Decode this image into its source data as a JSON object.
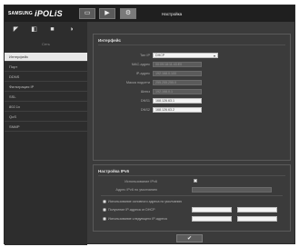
{
  "header": {
    "brand": "SAMSUNG",
    "product": "iPOLiS",
    "title": "Настройка",
    "buttons": [
      {
        "icon": "monitor-icon",
        "glyph": "▭"
      },
      {
        "icon": "playback-icon",
        "glyph": "▶"
      },
      {
        "icon": "settings-icon",
        "glyph": "⚙"
      }
    ]
  },
  "sidebar": {
    "icons": [
      {
        "icon": "video-icon",
        "glyph": "◤"
      },
      {
        "icon": "network-icon",
        "glyph": "◧"
      },
      {
        "icon": "event-icon",
        "glyph": "■"
      },
      {
        "icon": "system-icon",
        "glyph": "◑"
      }
    ],
    "caption": "Сеть",
    "items": [
      {
        "label": "Интерфейс",
        "active": true
      },
      {
        "label": "Порт",
        "active": false
      },
      {
        "label": "DDNS",
        "active": false
      },
      {
        "label": "Фильтрация IP",
        "active": false
      },
      {
        "label": "SSL",
        "active": false
      },
      {
        "label": "802.1x",
        "active": false
      },
      {
        "label": "QoS",
        "active": false
      },
      {
        "label": "SNMP",
        "active": false
      }
    ]
  },
  "interface": {
    "title": "Интерфейс",
    "fields": [
      {
        "label": "Тип IP",
        "value": "DHCP",
        "style": "select"
      },
      {
        "label": "MAC-адрес",
        "value": "00:09:18:11:43:E0",
        "style": "grey"
      },
      {
        "label": "IP-адрес",
        "value": "192.168.0.100",
        "style": "grey"
      },
      {
        "label": "Маска подсети",
        "value": "255.255.255.0",
        "style": "grey"
      },
      {
        "label": "Шлюз",
        "value": "192.168.0.1",
        "style": "grey"
      },
      {
        "label": "DNS1",
        "value": "168.126.63.1",
        "style": "white"
      },
      {
        "label": "DNS2",
        "value": "168.126.63.2",
        "style": "white"
      }
    ]
  },
  "ipv6": {
    "title": "Настройка IPv6",
    "use_label": "Использование IPv6",
    "default_label": "Адрес IPv6 по умолчанию",
    "options": [
      {
        "label": "Использование основного адреса по умолчанию"
      },
      {
        "label": "Получение IP-адреса от DHCP"
      },
      {
        "label": "Использование следующего IP-адреса"
      }
    ]
  },
  "apply": {
    "glyph": "✔"
  }
}
